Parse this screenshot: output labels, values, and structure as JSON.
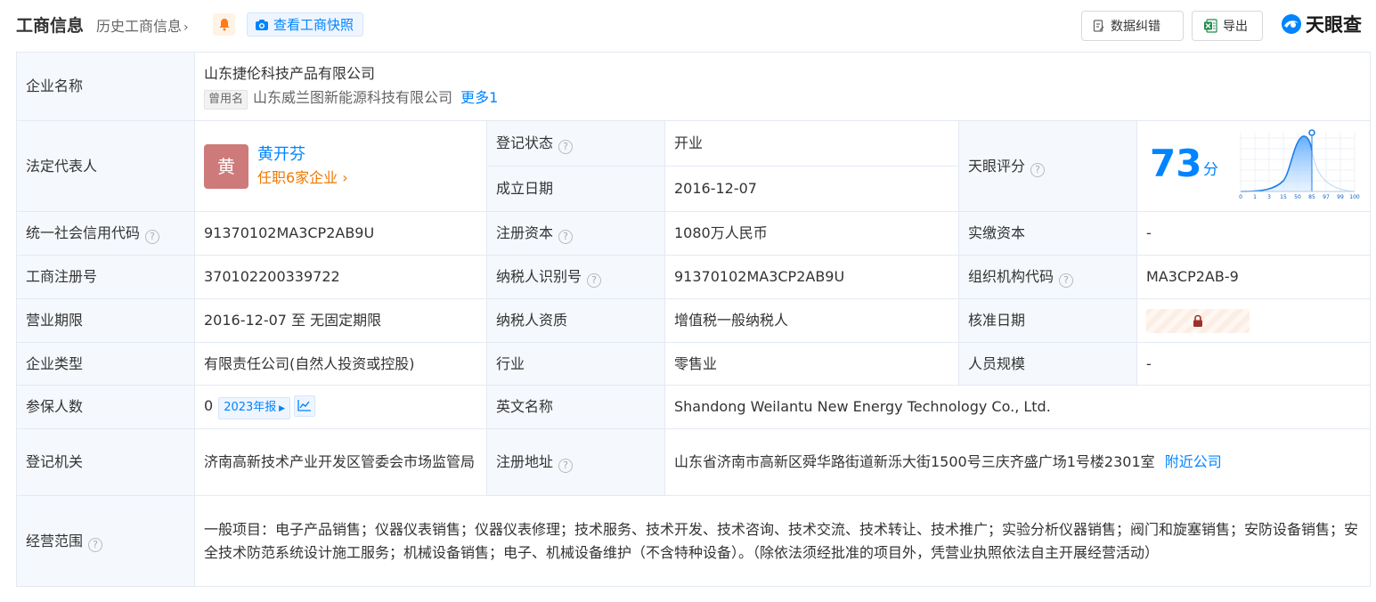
{
  "header": {
    "title": "工商信息",
    "history_label": "历史工商信息",
    "snapshot_label": "查看工商快照",
    "correct_label": "数据纠错",
    "export_label": "导出",
    "logo_text": "天眼查"
  },
  "labels": {
    "name": "企业名称",
    "legal_rep": "法定代表人",
    "reg_status": "登记状态",
    "est_date": "成立日期",
    "tianyan_score": "天眼评分",
    "credit_code": "统一社会信用代码",
    "reg_capital": "注册资本",
    "paid_capital": "实缴资本",
    "reg_no": "工商注册号",
    "taxpayer_id": "纳税人识别号",
    "org_code": "组织机构代码",
    "term": "营业期限",
    "taxpayer_qual": "纳税人资质",
    "approve_date": "核准日期",
    "company_type": "企业类型",
    "industry": "行业",
    "staff_size": "人员规模",
    "insured": "参保人数",
    "english_name": "英文名称",
    "authority": "登记机关",
    "reg_address": "注册地址",
    "scope": "经营范围"
  },
  "company": {
    "name": "山东捷伦科技产品有限公司",
    "former_tag": "曾用名",
    "former_name": "山东威兰图新能源科技有限公司",
    "more_link": "更多1",
    "legal_rep_avatar": "黄",
    "legal_rep_name": "黄开芬",
    "legal_rep_sub": "任职6家企业",
    "reg_status": "开业",
    "est_date": "2016-12-07",
    "score": "73",
    "score_unit": "分",
    "credit_code": "91370102MA3CP2AB9U",
    "reg_capital": "1080万人民币",
    "paid_capital": "-",
    "reg_no": "370102200339722",
    "taxpayer_id": "91370102MA3CP2AB9U",
    "org_code": "MA3CP2AB-9",
    "term": "2016-12-07 至 无固定期限",
    "taxpayer_qual": "增值税一般纳税人",
    "company_type": "有限责任公司(自然人投资或控股)",
    "industry": "零售业",
    "staff_size": "-",
    "insured_count": "0",
    "insured_year": "2023年报",
    "english_name": "Shandong Weilantu New Energy Technology Co., Ltd.",
    "authority": "济南高新技术产业开发区管委会市场监管局",
    "reg_address": "山东省济南市高新区舜华路街道新泺大街1500号三庆齐盛广场1号楼2301室",
    "nearby_link": "附近公司",
    "scope": "一般项目：电子产品销售；仪器仪表销售；仪器仪表修理；技术服务、技术开发、技术咨询、技术交流、技术转让、技术推广；实验分析仪器销售；阀门和旋塞销售；安防设备销售；安全技术防范系统设计施工服务；机械设备销售；电子、机械设备维护（不含特种设备）。（除依法须经批准的项目外，凭营业执照依法自主开展经营活动）"
  },
  "score_chart": {
    "ticks": [
      "0",
      "1",
      "3",
      "15",
      "50",
      "85",
      "97",
      "99",
      "100"
    ],
    "marker_tick_index": 5
  },
  "colors": {
    "accent": "#0084ff",
    "status_green": "#17a34a",
    "link_orange": "#f07800",
    "label_bg": "#f5f8fd",
    "border": "#e4eaf3"
  }
}
